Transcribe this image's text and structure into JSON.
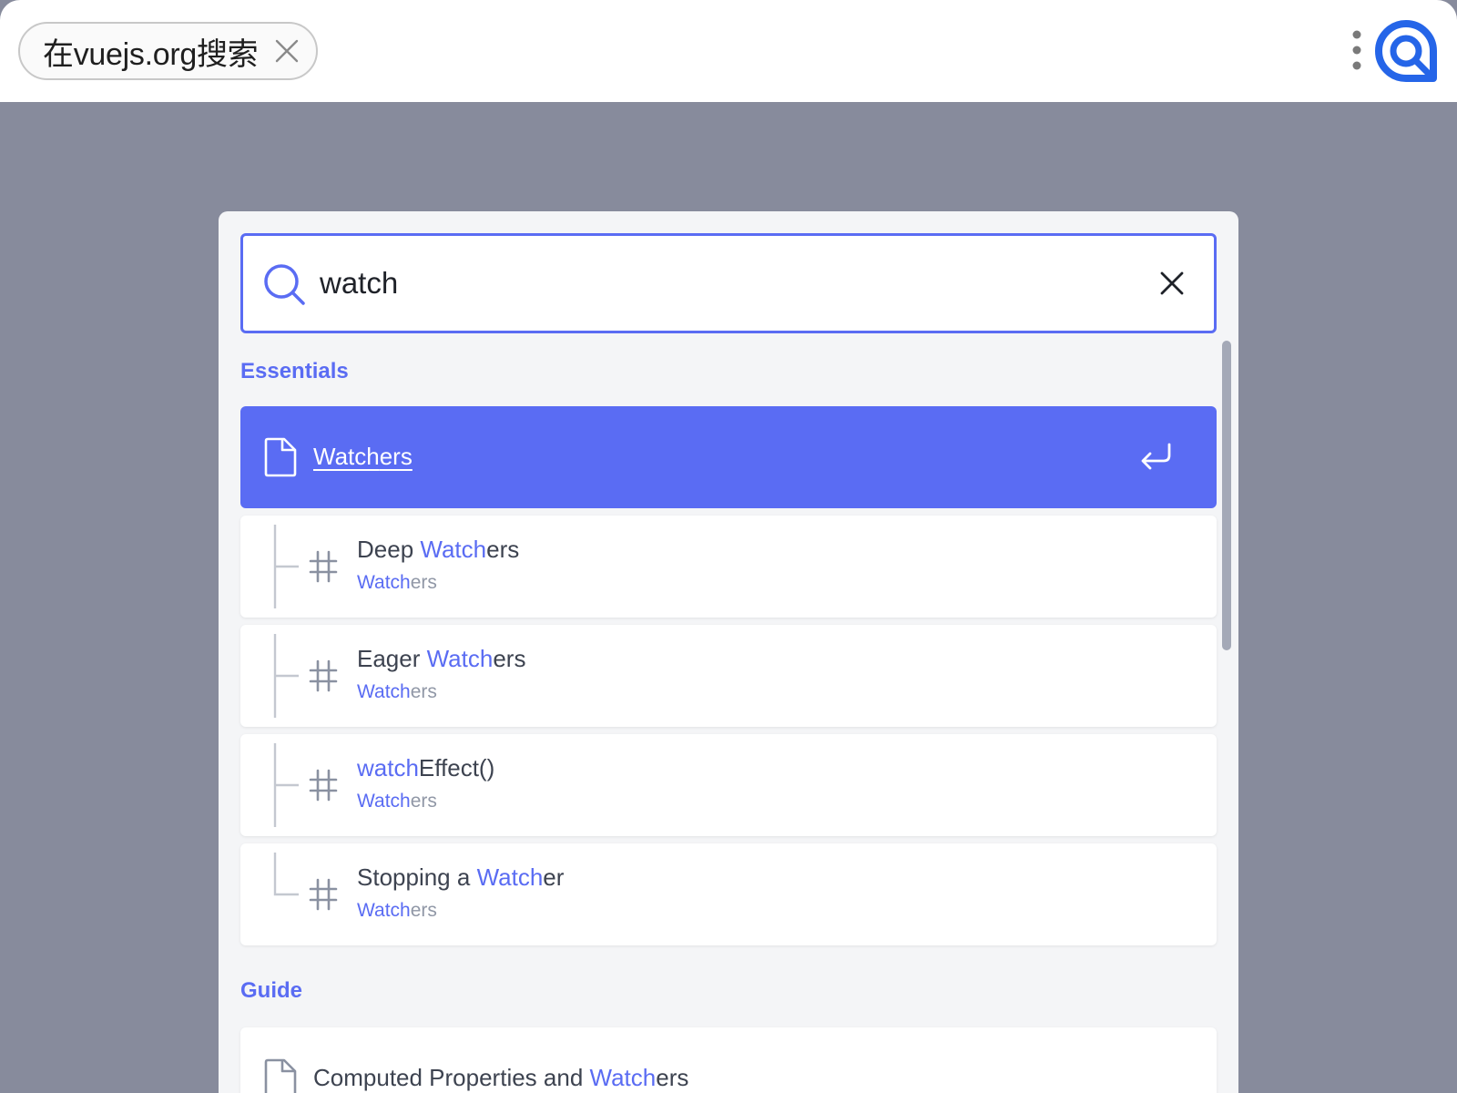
{
  "browser": {
    "search_chip_label": "在vuejs.org搜索"
  },
  "search": {
    "query": "watch"
  },
  "sections": {
    "essentials": {
      "title": "Essentials",
      "selected_hit": {
        "highlight": "Watch",
        "rest": "ers"
      },
      "sub_hits": [
        {
          "prefix": "Deep ",
          "highlight": "Watch",
          "rest": "ers",
          "parent_highlight": "Watch",
          "parent_rest": "ers"
        },
        {
          "prefix": "Eager ",
          "highlight": "Watch",
          "rest": "ers",
          "parent_highlight": "Watch",
          "parent_rest": "ers"
        },
        {
          "prefix": "",
          "highlight": "watch",
          "rest": "Effect()",
          "parent_highlight": "Watch",
          "parent_rest": "ers"
        },
        {
          "prefix": "Stopping a ",
          "highlight": "Watch",
          "rest": "er",
          "parent_highlight": "Watch",
          "parent_rest": "ers"
        }
      ]
    },
    "guide": {
      "title": "Guide",
      "hit": {
        "prefix": "Computed Properties and ",
        "highlight": "Watch",
        "rest": "ers"
      }
    }
  },
  "icons": {
    "chip_close": "close-icon",
    "menu": "kebab-menu-icon",
    "logo": "search-brand-logo-icon",
    "search": "search-icon",
    "clear": "close-icon",
    "page": "document-icon",
    "enter": "enter-key-icon",
    "heading": "hash-icon"
  },
  "colors": {
    "accent": "#5a6cf3",
    "overlay": "#878b9c",
    "modal_bg": "#f4f5f7",
    "text": "#3d4350",
    "muted": "#9097a6"
  }
}
